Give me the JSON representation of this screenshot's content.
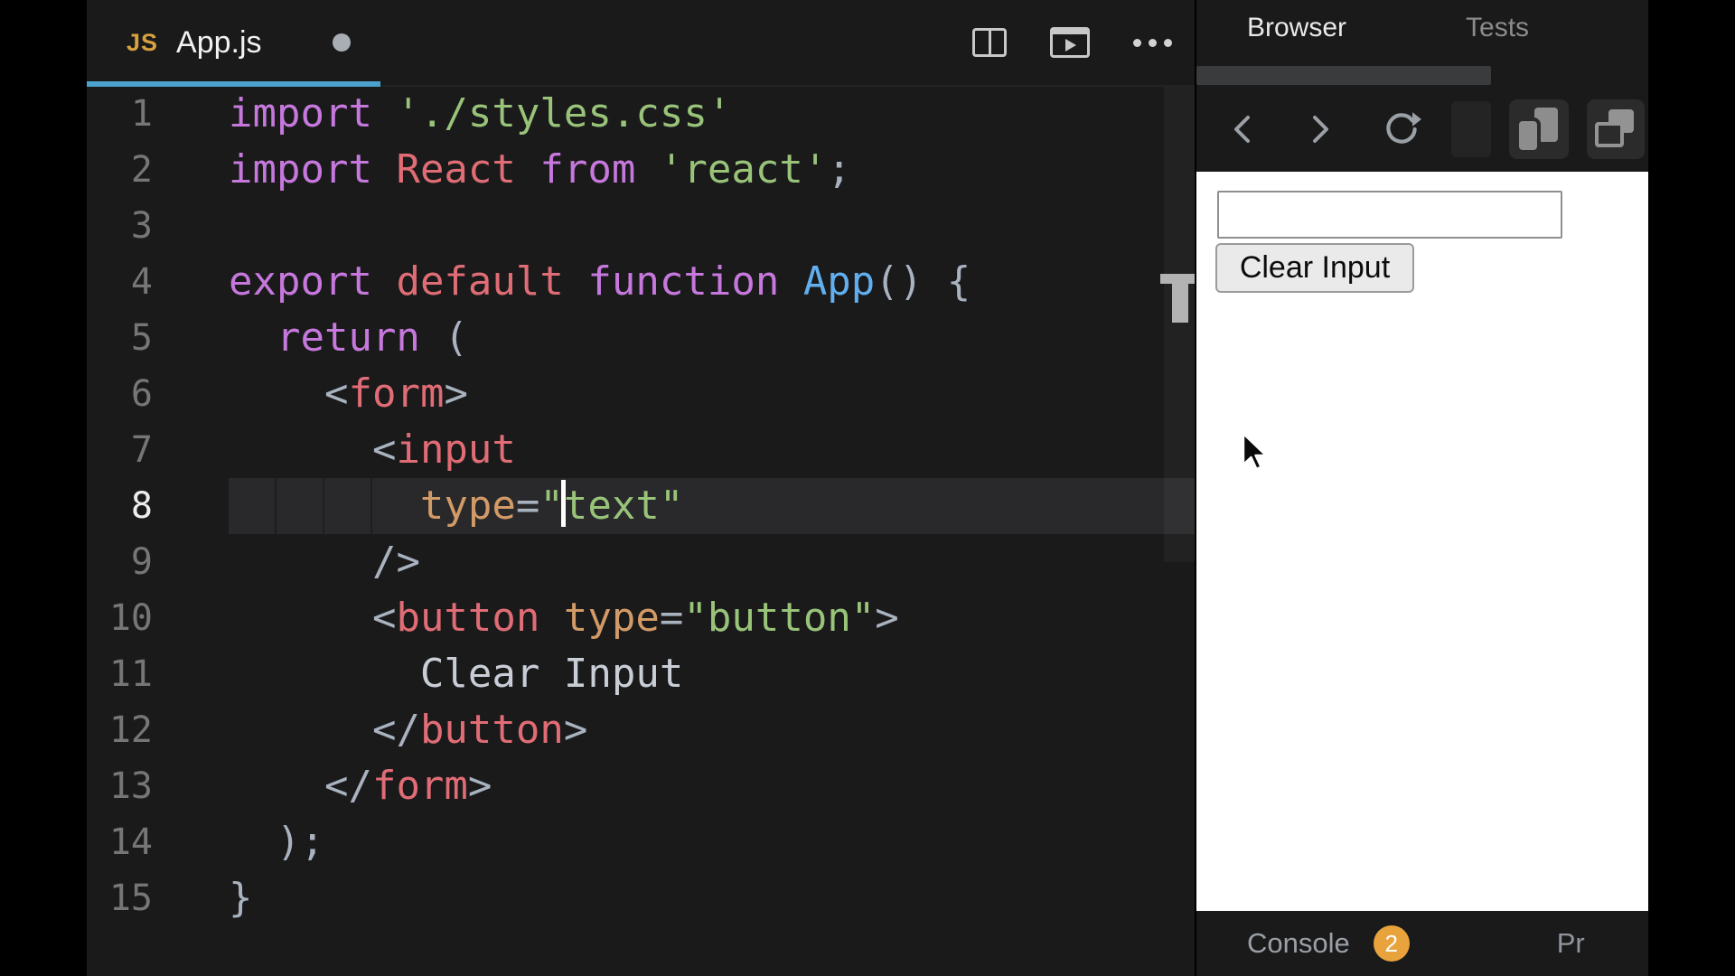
{
  "editor": {
    "tab": {
      "badge": "JS",
      "title": "App.js",
      "modified": true
    },
    "toolbar_icons": [
      "split-editor",
      "open-preview",
      "more-options"
    ],
    "active_line": 8,
    "lines": [
      {
        "n": "1",
        "t": [
          [
            "kw",
            "import"
          ],
          [
            "pl",
            " "
          ],
          [
            "str",
            "'./styles.css'"
          ]
        ]
      },
      {
        "n": "2",
        "t": [
          [
            "kw",
            "import"
          ],
          [
            "pl",
            " "
          ],
          [
            "red",
            "React"
          ],
          [
            "pl",
            " "
          ],
          [
            "kw",
            "from"
          ],
          [
            "pl",
            " "
          ],
          [
            "str",
            "'react'"
          ],
          [
            "pun",
            ";"
          ]
        ]
      },
      {
        "n": "3",
        "t": []
      },
      {
        "n": "4",
        "t": [
          [
            "kw",
            "export"
          ],
          [
            "pl",
            " "
          ],
          [
            "red",
            "default"
          ],
          [
            "pl",
            " "
          ],
          [
            "kw",
            "function"
          ],
          [
            "pl",
            " "
          ],
          [
            "blue",
            "App"
          ],
          [
            "pun",
            "() {"
          ]
        ]
      },
      {
        "n": "5",
        "t": [
          [
            "pl",
            "  "
          ],
          [
            "kw",
            "return"
          ],
          [
            "pl",
            " "
          ],
          [
            "pun",
            "("
          ]
        ]
      },
      {
        "n": "6",
        "t": [
          [
            "pl",
            "    "
          ],
          [
            "pun",
            "<"
          ],
          [
            "red",
            "form"
          ],
          [
            "pun",
            ">"
          ]
        ]
      },
      {
        "n": "7",
        "t": [
          [
            "pl",
            "      "
          ],
          [
            "pun",
            "<"
          ],
          [
            "red",
            "input"
          ]
        ]
      },
      {
        "n": "8",
        "t": [
          [
            "pl",
            "        "
          ],
          [
            "attr",
            "type"
          ],
          [
            "pun",
            "="
          ],
          [
            "str",
            "\""
          ],
          [
            "cursor",
            ""
          ],
          [
            "str",
            "text\""
          ]
        ],
        "active": true
      },
      {
        "n": "9",
        "t": [
          [
            "pl",
            "      "
          ],
          [
            "pun",
            "/>"
          ]
        ]
      },
      {
        "n": "10",
        "t": [
          [
            "pl",
            "      "
          ],
          [
            "pun",
            "<"
          ],
          [
            "red",
            "button"
          ],
          [
            "pl",
            " "
          ],
          [
            "attr",
            "type"
          ],
          [
            "pun",
            "="
          ],
          [
            "str",
            "\"button\""
          ],
          [
            "pun",
            ">"
          ]
        ]
      },
      {
        "n": "11",
        "t": [
          [
            "pl",
            "        "
          ],
          [
            "txt",
            "Clear Input"
          ]
        ]
      },
      {
        "n": "12",
        "t": [
          [
            "pl",
            "      "
          ],
          [
            "pun",
            "</"
          ],
          [
            "red",
            "button"
          ],
          [
            "pun",
            ">"
          ]
        ]
      },
      {
        "n": "13",
        "t": [
          [
            "pl",
            "    "
          ],
          [
            "pun",
            "</"
          ],
          [
            "red",
            "form"
          ],
          [
            "pun",
            ">"
          ]
        ]
      },
      {
        "n": "14",
        "t": [
          [
            "pl",
            "  "
          ],
          [
            "pun",
            ");"
          ]
        ]
      },
      {
        "n": "15",
        "t": [
          [
            "pun",
            "}"
          ]
        ]
      }
    ],
    "colors": {
      "keyword": "#c678dd",
      "tag": "#e06c75",
      "string": "#98c379",
      "function_name": "#61afef",
      "attribute": "#d19a66",
      "punctuation": "#a9b2bf",
      "active_tab_underline": "#4ba2cf",
      "js_badge": "#d7a13f"
    }
  },
  "panel": {
    "tabs": [
      {
        "label": "Browser",
        "active": true
      },
      {
        "label": "Tests",
        "active": false
      }
    ],
    "nav_icons": [
      "back",
      "forward",
      "refresh",
      "divider-pill",
      "device-preview",
      "open-new-window"
    ],
    "content": {
      "input_value": "",
      "button_label": "Clear Input"
    },
    "footer": {
      "console_label": "Console",
      "badge_count": "2",
      "badge_color": "#e8a33c",
      "partial_label": "Pr"
    }
  }
}
